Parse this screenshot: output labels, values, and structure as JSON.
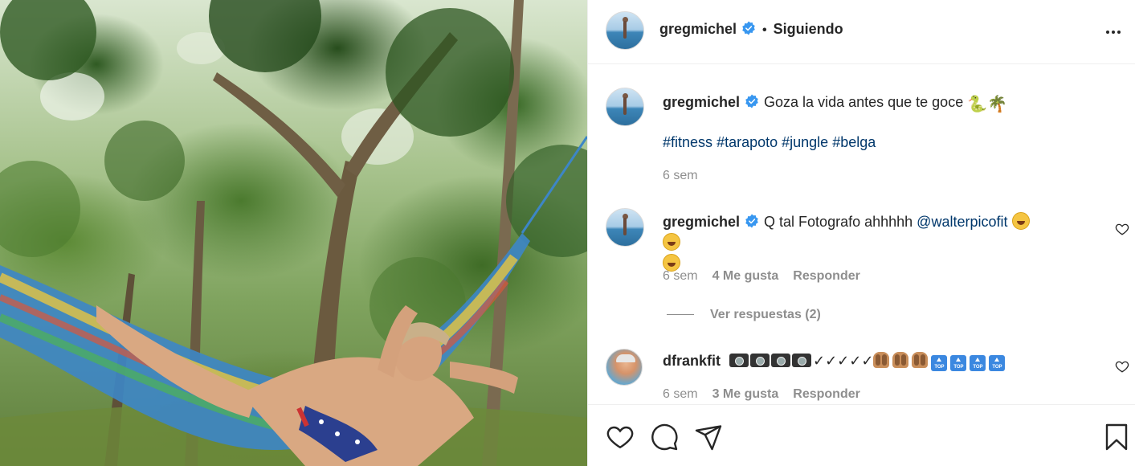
{
  "post": {
    "author": "gregmichel",
    "separator": "•",
    "follow_status": "Siguiendo"
  },
  "caption": {
    "username": "gregmichel",
    "text": "Goza la vida antes que te goce",
    "emoji_1": "🐍",
    "emoji_2": "🌴",
    "hashtags": [
      "#fitness",
      "#tarapoto",
      "#jungle",
      "#belga"
    ],
    "time": "6 sem"
  },
  "comments": [
    {
      "username": "gregmichel",
      "text": "Q tal Fotografo ahhhhh",
      "mention": "@walterpicofit",
      "time": "6 sem",
      "likes": "4 Me gusta",
      "reply": "Responder",
      "view_replies": "Ver respuestas (2)"
    },
    {
      "username": "dfrankfit",
      "checks": "✓✓✓✓✓",
      "time": "6 sem",
      "likes": "3 Me gusta",
      "reply": "Responder"
    }
  ],
  "colors": {
    "verified": "#3897f0",
    "link": "#00376b",
    "muted": "#8e8e8e"
  }
}
